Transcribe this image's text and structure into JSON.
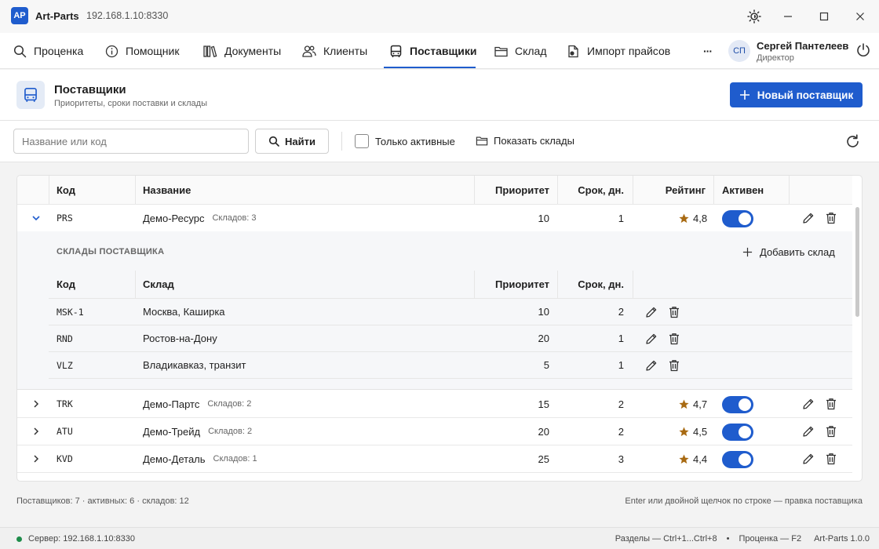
{
  "titlebar": {
    "logo": "AP",
    "app_name": "Art-Parts",
    "address": "192.168.1.10:8330"
  },
  "nav": {
    "items": [
      {
        "label": "Проценка",
        "icon": "search-icon"
      },
      {
        "label": "Помощник",
        "icon": "info-icon"
      },
      {
        "label": "Документы",
        "icon": "books-icon"
      },
      {
        "label": "Клиенты",
        "icon": "users-icon"
      },
      {
        "label": "Поставщики",
        "icon": "bus-icon",
        "active": true
      },
      {
        "label": "Склад",
        "icon": "folder-icon"
      },
      {
        "label": "Импорт прайсов",
        "icon": "file-import-icon"
      }
    ],
    "more": "···",
    "user": {
      "initials": "СП",
      "name": "Сергей Пантелеев",
      "role": "Директор"
    }
  },
  "header": {
    "title": "Поставщики",
    "subtitle": "Приоритеты, сроки поставки и склады",
    "new_button": "Новый поставщик"
  },
  "toolbar": {
    "search_placeholder": "Название или код",
    "find_button": "Найти",
    "only_active": "Только активные",
    "only_active_checked": false,
    "show_warehouses": "Показать склады"
  },
  "table": {
    "columns": [
      "Код",
      "Название",
      "Приоритет",
      "Срок, дн.",
      "Рейтинг",
      "Активен"
    ],
    "rows": [
      {
        "code": "PRS",
        "name": "Демо-Ресурс",
        "warehouses": "Складов: 3",
        "priority": "10",
        "term": "1",
        "rating": "4,8",
        "active": true,
        "expanded": true
      },
      {
        "code": "TRK",
        "name": "Демо-Партс",
        "warehouses": "Складов: 2",
        "priority": "15",
        "term": "2",
        "rating": "4,7",
        "active": true,
        "expanded": false
      },
      {
        "code": "ATU",
        "name": "Демо-Трейд",
        "warehouses": "Складов: 2",
        "priority": "20",
        "term": "2",
        "rating": "4,5",
        "active": true,
        "expanded": false
      },
      {
        "code": "KVD",
        "name": "Демо-Деталь",
        "warehouses": "Складов: 1",
        "priority": "25",
        "term": "3",
        "rating": "4,4",
        "active": true,
        "expanded": false
      }
    ]
  },
  "subtable": {
    "caption": "СКЛАДЫ ПОСТАВЩИКА",
    "add_button": "Добавить склад",
    "columns": [
      "Код",
      "Склад",
      "Приоритет",
      "Срок, дн."
    ],
    "rows": [
      {
        "code": "MSK-1",
        "name": "Москва, Каширка",
        "priority": "10",
        "term": "2"
      },
      {
        "code": "RND",
        "name": "Ростов-на-Дону",
        "priority": "20",
        "term": "1"
      },
      {
        "code": "VLZ",
        "name": "Владикавказ, транзит",
        "priority": "5",
        "term": "1"
      }
    ]
  },
  "footer": {
    "summary": "Поставщиков: 7 · активных: 6 · складов: 12",
    "hint": "Enter или двойной щелчок по строке — правка поставщика"
  },
  "statusbar": {
    "server": "Сервер: 192.168.1.10:8330",
    "sections": "Разделы — Ctrl+1...Ctrl+8",
    "bullet": "•",
    "pricing": "Проценка — F2",
    "version": "Art-Parts 1.0.0"
  },
  "colors": {
    "accent": "#1f5ccd",
    "star": "#a86a12",
    "status_ok": "#1e8c4a"
  }
}
